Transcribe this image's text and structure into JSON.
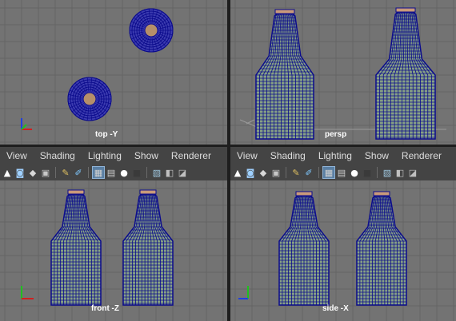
{
  "colors": {
    "viewport_bg": "#737373",
    "grid_line": "#656565",
    "wire": "#0b0b8c",
    "fill": "#86a085",
    "panel_bg": "#444444",
    "active_tool": "#5a7fa3",
    "axis_x": "#d02020",
    "axis_y": "#20c020",
    "axis_z": "#2040e0"
  },
  "viewports": {
    "top": {
      "label": "top -Y"
    },
    "persp": {
      "label": "persp"
    },
    "front": {
      "label": "front -Z"
    },
    "side": {
      "label": "side -X"
    }
  },
  "panel_menus": {
    "left": [
      "View",
      "Shading",
      "Lighting",
      "Show",
      "Renderer"
    ],
    "right": [
      "View",
      "Shading",
      "Lighting",
      "Show",
      "Renderer"
    ]
  },
  "toolbar_icons": [
    "camera-select-icon",
    "camera-attributes-icon",
    "bookmark-icon",
    "image-plane-icon",
    "two-d-pan-zoom-icon",
    "grease-pencil-icon",
    "grid-icon",
    "wireframe-on-shaded-icon",
    "smooth-shade-icon",
    "use-default-material-icon",
    "textured-icon",
    "shadows-icon",
    "isolate-select-icon"
  ]
}
